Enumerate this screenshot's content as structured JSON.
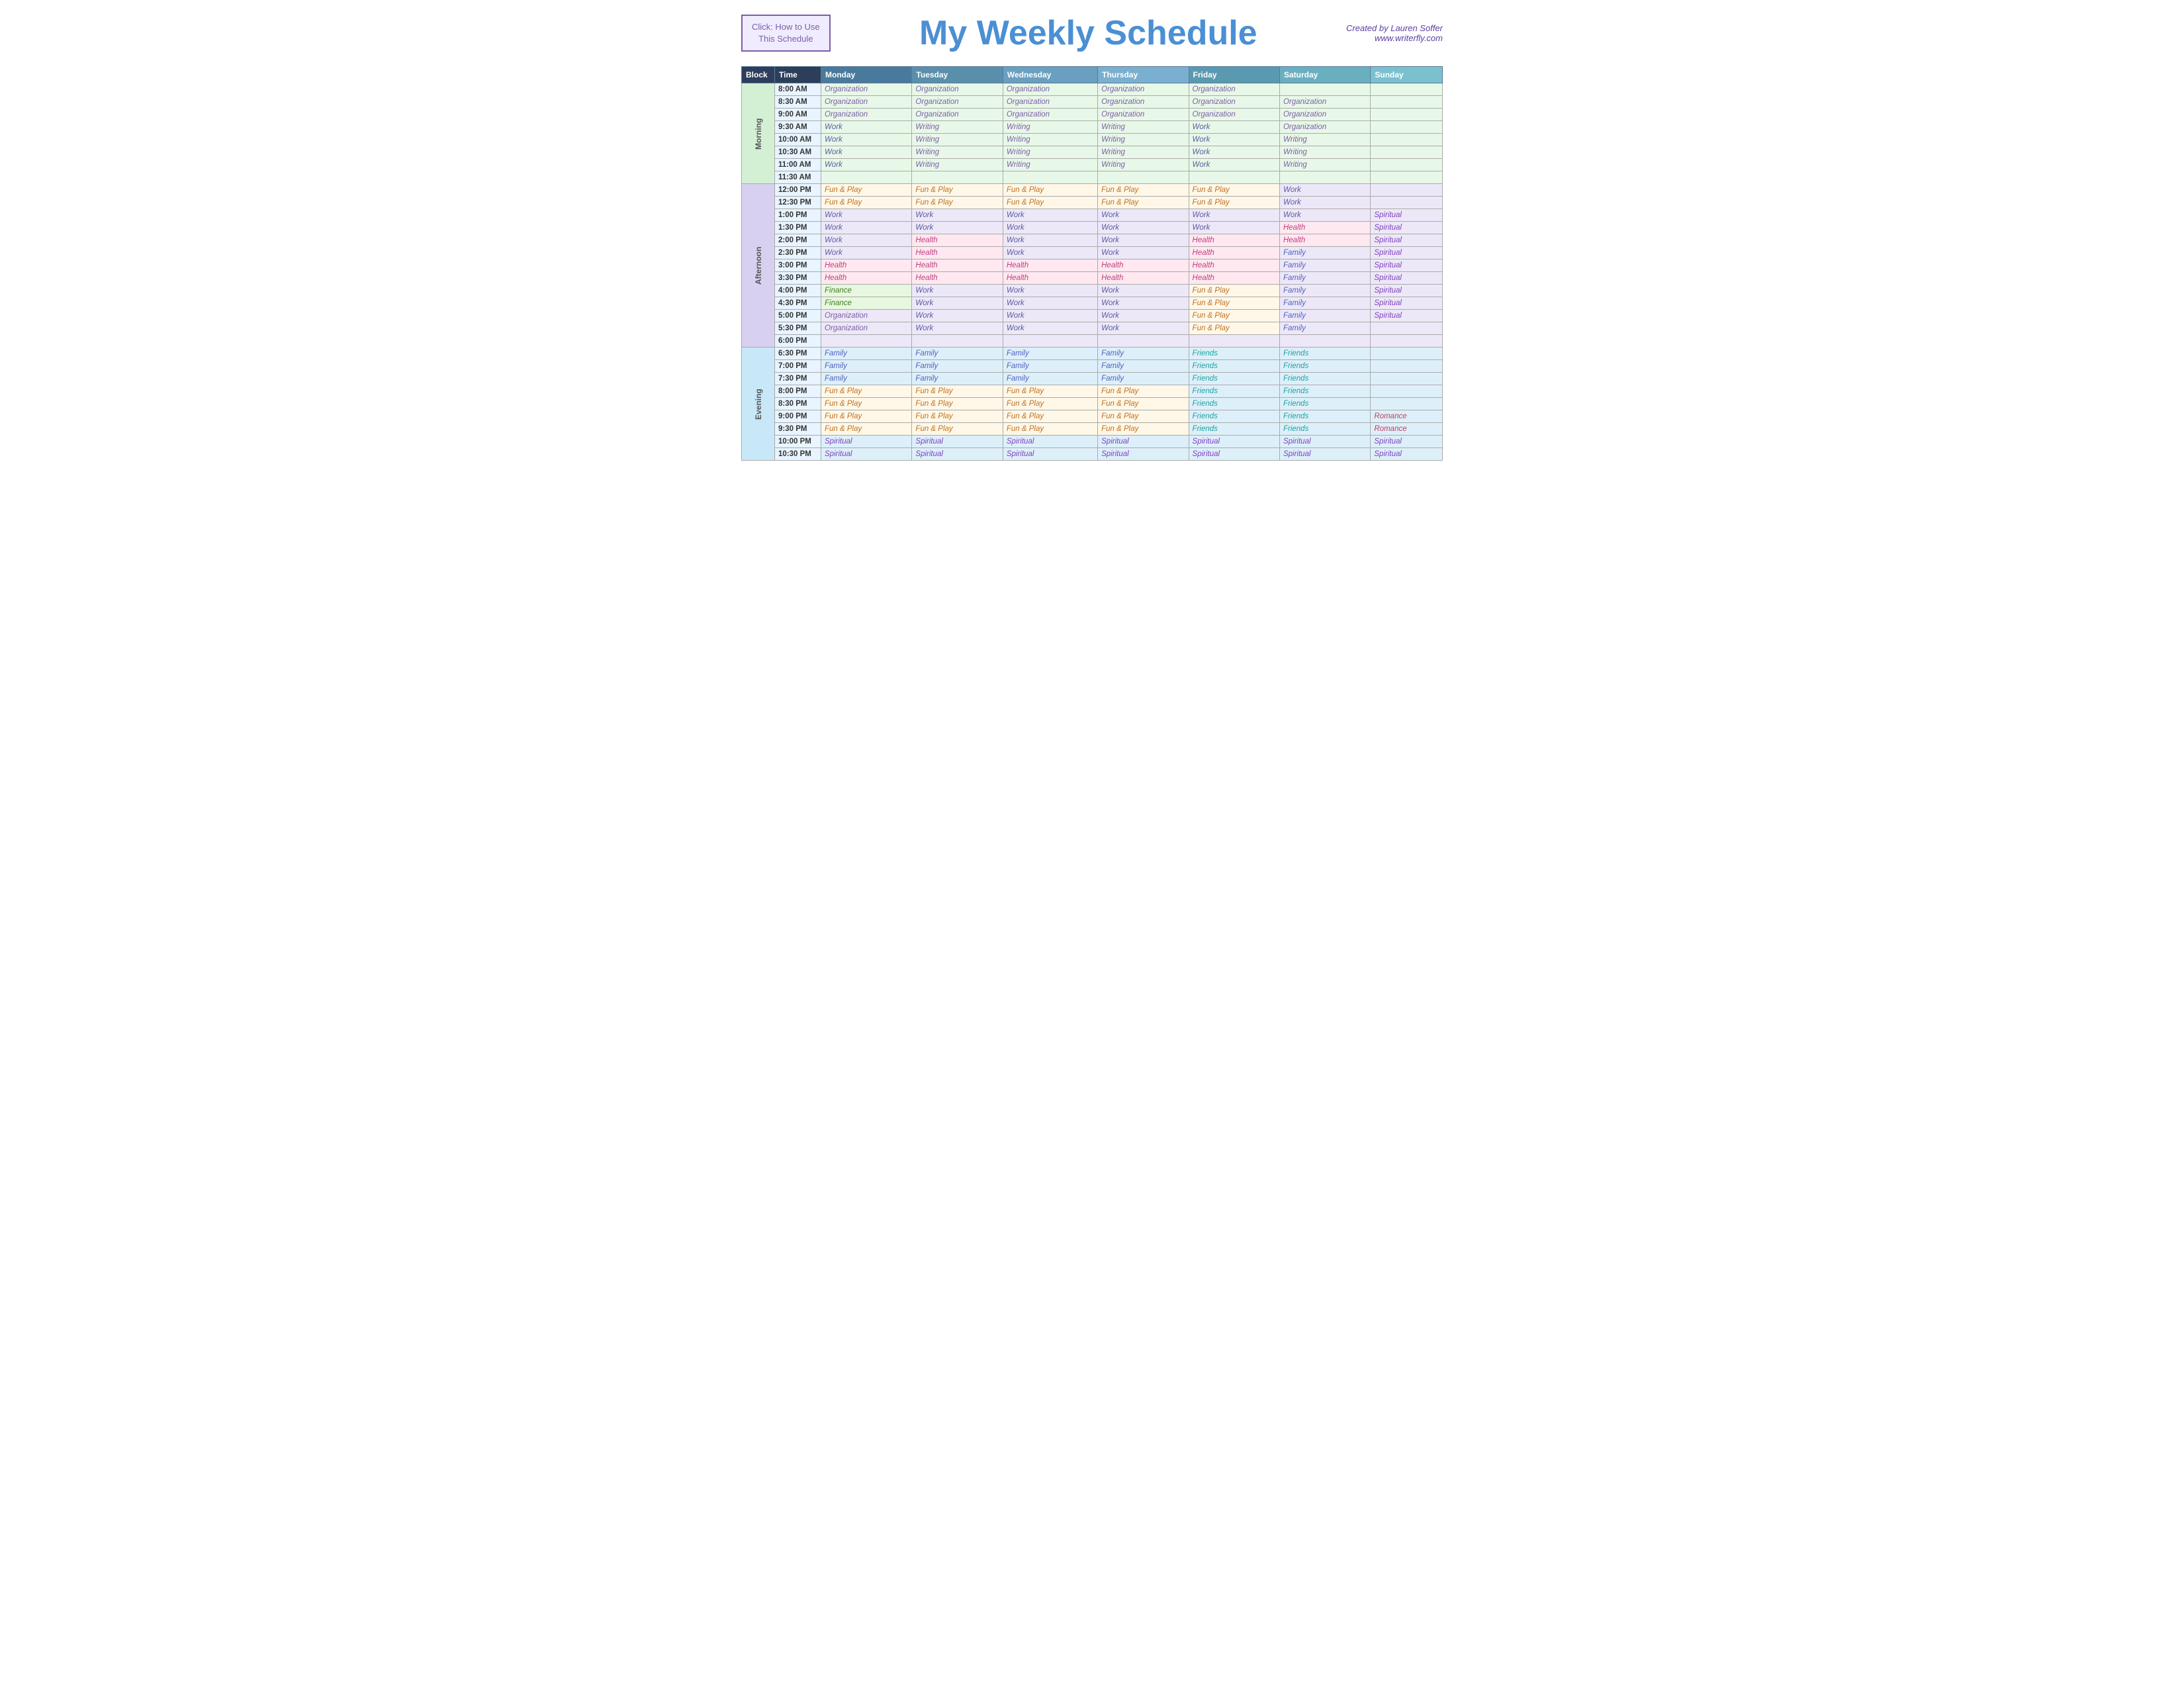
{
  "header": {
    "button_line1": "Click:  How to Use",
    "button_line2": "This Schedule",
    "title_my": "My ",
    "title_weekly": "Weekly ",
    "title_schedule": "Schedule",
    "creator": "Created by Lauren Soffer",
    "website": "www.writerfly.com"
  },
  "table": {
    "columns": [
      "Block",
      "Time",
      "Monday",
      "Tuesday",
      "Wednesday",
      "Thursday",
      "Friday",
      "Saturday",
      "Sunday"
    ],
    "rows": [
      {
        "block": "Morning",
        "time": "8:00 AM",
        "mon": "Organization",
        "tue": "Organization",
        "wed": "Organization",
        "thu": "Organization",
        "fri": "Organization",
        "sat": "",
        "sun": ""
      },
      {
        "block": "",
        "time": "8:30 AM",
        "mon": "Organization",
        "tue": "Organization",
        "wed": "Organization",
        "thu": "Organization",
        "fri": "Organization",
        "sat": "Organization",
        "sun": ""
      },
      {
        "block": "",
        "time": "9:00 AM",
        "mon": "Organization",
        "tue": "Organization",
        "wed": "Organization",
        "thu": "Organization",
        "fri": "Organization",
        "sat": "Organization",
        "sun": ""
      },
      {
        "block": "",
        "time": "9:30 AM",
        "mon": "Work",
        "tue": "Writing",
        "wed": "Writing",
        "thu": "Writing",
        "fri": "Work",
        "sat": "Organization",
        "sun": ""
      },
      {
        "block": "",
        "time": "10:00 AM",
        "mon": "Work",
        "tue": "Writing",
        "wed": "Writing",
        "thu": "Writing",
        "fri": "Work",
        "sat": "Writing",
        "sun": ""
      },
      {
        "block": "",
        "time": "10:30 AM",
        "mon": "Work",
        "tue": "Writing",
        "wed": "Writing",
        "thu": "Writing",
        "fri": "Work",
        "sat": "Writing",
        "sun": ""
      },
      {
        "block": "",
        "time": "11:00 AM",
        "mon": "Work",
        "tue": "Writing",
        "wed": "Writing",
        "thu": "Writing",
        "fri": "Work",
        "sat": "Writing",
        "sun": ""
      },
      {
        "block": "",
        "time": "11:30 AM",
        "mon": "",
        "tue": "",
        "wed": "",
        "thu": "",
        "fri": "",
        "sat": "",
        "sun": ""
      },
      {
        "block": "Afternoon",
        "time": "12:00 PM",
        "mon": "Fun & Play",
        "tue": "Fun & Play",
        "wed": "Fun & Play",
        "thu": "Fun & Play",
        "fri": "Fun & Play",
        "sat": "Work",
        "sun": ""
      },
      {
        "block": "",
        "time": "12:30 PM",
        "mon": "Fun & Play",
        "tue": "Fun & Play",
        "wed": "Fun & Play",
        "thu": "Fun & Play",
        "fri": "Fun & Play",
        "sat": "Work",
        "sun": ""
      },
      {
        "block": "",
        "time": "1:00 PM",
        "mon": "Work",
        "tue": "Work",
        "wed": "Work",
        "thu": "Work",
        "fri": "Work",
        "sat": "Work",
        "sun": "Spiritual"
      },
      {
        "block": "",
        "time": "1:30 PM",
        "mon": "Work",
        "tue": "Work",
        "wed": "Work",
        "thu": "Work",
        "fri": "Work",
        "sat": "Health",
        "sun": "Spiritual"
      },
      {
        "block": "",
        "time": "2:00 PM",
        "mon": "Work",
        "tue": "Health",
        "wed": "Work",
        "thu": "Work",
        "fri": "Health",
        "sat": "Health",
        "sun": "Spiritual"
      },
      {
        "block": "",
        "time": "2:30 PM",
        "mon": "Work",
        "tue": "Health",
        "wed": "Work",
        "thu": "Work",
        "fri": "Health",
        "sat": "Family",
        "sun": "Spiritual"
      },
      {
        "block": "",
        "time": "3:00 PM",
        "mon": "Health",
        "tue": "Health",
        "wed": "Health",
        "thu": "Health",
        "fri": "Health",
        "sat": "Family",
        "sun": "Spiritual"
      },
      {
        "block": "",
        "time": "3:30 PM",
        "mon": "Health",
        "tue": "Health",
        "wed": "Health",
        "thu": "Health",
        "fri": "Health",
        "sat": "Family",
        "sun": "Spiritual"
      },
      {
        "block": "",
        "time": "4:00 PM",
        "mon": "Finance",
        "tue": "Work",
        "wed": "Work",
        "thu": "Work",
        "fri": "Fun & Play",
        "sat": "Family",
        "sun": "Spiritual"
      },
      {
        "block": "",
        "time": "4:30 PM",
        "mon": "Finance",
        "tue": "Work",
        "wed": "Work",
        "thu": "Work",
        "fri": "Fun & Play",
        "sat": "Family",
        "sun": "Spiritual"
      },
      {
        "block": "",
        "time": "5:00 PM",
        "mon": "Organization",
        "tue": "Work",
        "wed": "Work",
        "thu": "Work",
        "fri": "Fun & Play",
        "sat": "Family",
        "sun": "Spiritual"
      },
      {
        "block": "",
        "time": "5:30 PM",
        "mon": "Organization",
        "tue": "Work",
        "wed": "Work",
        "thu": "Work",
        "fri": "Fun & Play",
        "sat": "Family",
        "sun": ""
      },
      {
        "block": "",
        "time": "6:00 PM",
        "mon": "",
        "tue": "",
        "wed": "",
        "thu": "",
        "fri": "",
        "sat": "",
        "sun": ""
      },
      {
        "block": "Evening",
        "time": "6:30 PM",
        "mon": "Family",
        "tue": "Family",
        "wed": "Family",
        "thu": "Family",
        "fri": "Friends",
        "sat": "Friends",
        "sun": ""
      },
      {
        "block": "",
        "time": "7:00 PM",
        "mon": "Family",
        "tue": "Family",
        "wed": "Family",
        "thu": "Family",
        "fri": "Friends",
        "sat": "Friends",
        "sun": ""
      },
      {
        "block": "",
        "time": "7:30 PM",
        "mon": "Family",
        "tue": "Family",
        "wed": "Family",
        "thu": "Family",
        "fri": "Friends",
        "sat": "Friends",
        "sun": ""
      },
      {
        "block": "",
        "time": "8:00 PM",
        "mon": "Fun & Play",
        "tue": "Fun & Play",
        "wed": "Fun & Play",
        "thu": "Fun & Play",
        "fri": "Friends",
        "sat": "Friends",
        "sun": ""
      },
      {
        "block": "",
        "time": "8:30 PM",
        "mon": "Fun & Play",
        "tue": "Fun & Play",
        "wed": "Fun & Play",
        "thu": "Fun & Play",
        "fri": "Friends",
        "sat": "Friends",
        "sun": ""
      },
      {
        "block": "",
        "time": "9:00 PM",
        "mon": "Fun & Play",
        "tue": "Fun & Play",
        "wed": "Fun & Play",
        "thu": "Fun & Play",
        "fri": "Friends",
        "sat": "Friends",
        "sun": "Romance"
      },
      {
        "block": "",
        "time": "9:30 PM",
        "mon": "Fun & Play",
        "tue": "Fun & Play",
        "wed": "Fun & Play",
        "thu": "Fun & Play",
        "fri": "Friends",
        "sat": "Friends",
        "sun": "Romance"
      },
      {
        "block": "",
        "time": "10:00 PM",
        "mon": "Spiritual",
        "tue": "Spiritual",
        "wed": "Spiritual",
        "thu": "Spiritual",
        "fri": "Spiritual",
        "sat": "Spiritual",
        "sun": "Spiritual"
      },
      {
        "block": "",
        "time": "10:30 PM",
        "mon": "Spiritual",
        "tue": "Spiritual",
        "wed": "Spiritual",
        "thu": "Spiritual",
        "fri": "Spiritual",
        "sat": "Spiritual",
        "sun": "Spiritual"
      }
    ]
  }
}
